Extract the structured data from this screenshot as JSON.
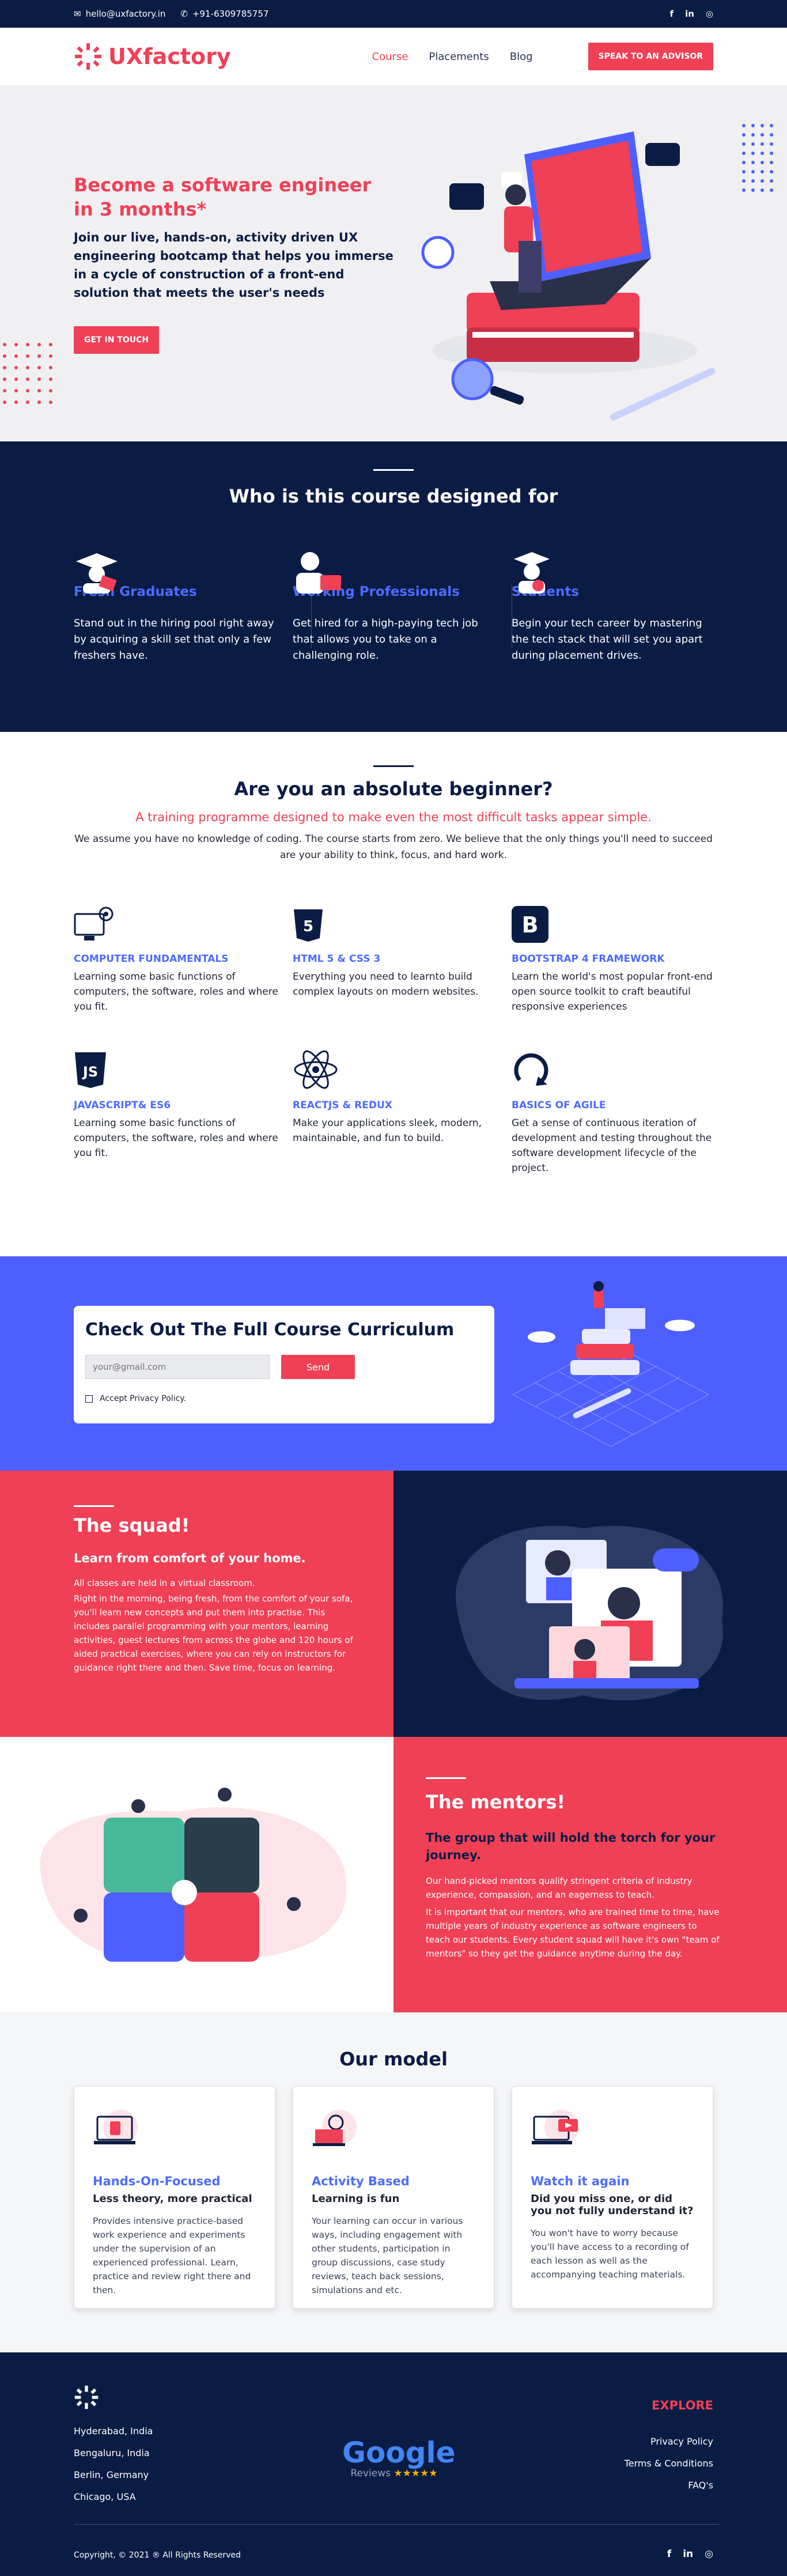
{
  "topbar": {
    "email": "hello@uxfactory.in",
    "phone": "+91-6309785757"
  },
  "brand": {
    "name": "UXfactory"
  },
  "nav": {
    "items": [
      "Course",
      "Placements",
      "Blog"
    ],
    "cta": "SPEAK TO AN ADVISOR"
  },
  "hero": {
    "title": "Become a software engineer in 3 months*",
    "desc": "Join our live, hands-on, activity driven UX engineering bootcamp that helps you immerse in a cycle of construction of a front-end solution that meets the user's needs",
    "cta": "GET IN TOUCH"
  },
  "audience": {
    "title": "Who is this course designed for",
    "cards": [
      {
        "title": "Fresh Graduates",
        "desc": "Stand out in the hiring pool right away by acquiring a skill set that only a few freshers have."
      },
      {
        "title": "Working Professionals",
        "desc": "Get hired for a high-paying tech job that allows you to take on a challenging role."
      },
      {
        "title": "Students",
        "desc": "Begin your tech career by mastering the tech stack that will set you apart during placement drives."
      }
    ]
  },
  "beginner": {
    "title": "Are you an absolute beginner?",
    "subtitle": "A training programme designed to make even the most difficult tasks appear simple.",
    "desc": "We assume you have no knowledge of coding. The course starts from zero. We believe that the only things you'll need to succeed are your ability to think, focus, and hard work.",
    "skills": [
      {
        "title": "COMPUTER FUNDAMENTALS",
        "desc": "Learning some basic functions of computers, the software, roles and where you fit."
      },
      {
        "title": "HTML 5 & CSS 3",
        "desc": "Everything you need to learnto build complex layouts on modern websites."
      },
      {
        "title": "BOOTSTRAP 4 FRAMEWORK",
        "desc": "Learn the world's most popular front-end open source toolkit to craft beautiful responsive experiences"
      },
      {
        "title": "JAVASCRIPT& ES6",
        "desc": "Learning some basic functions of computers, the software, roles and where you fit."
      },
      {
        "title": "REACTJS & REDUX",
        "desc": "Make your applications sleek, modern, maintainable, and fun to build."
      },
      {
        "title": "BASICS OF AGILE",
        "desc": "Get a sense of continuous iteration of development and testing throughout the software development lifecycle of the project."
      }
    ]
  },
  "curriculum": {
    "title": "Check Out The Full Course Curriculum",
    "placeholder": "your@gmail.com",
    "send": "Send",
    "privacy": "Accept Privacy Policy."
  },
  "squad": {
    "title": "The squad!",
    "subtitle": "Learn from comfort of your home.",
    "p1": "All classes are held in a virtual classroom.",
    "p2": "Right in the morning, being fresh, from the comfort of your sofa, you'll learn new concepts and put them into practise. This includes parallel programming with your mentors, learning activities, guest lectures from across the globe and 120 hours of aided practical exercises, where you can rely on instructors for guidance right there and then. Save time, focus on learning."
  },
  "mentors": {
    "title": "The mentors!",
    "subtitle": "The group that will hold the torch for your journey.",
    "p1": "Our hand-picked mentors qualify stringent criteria of industry experience, compassion, and an eagerness to teach.",
    "p2": "It is important that our mentors, who are trained time to time, have multiple years of industry experience as software engineers to teach our students. Every student squad will have it's own \"team of mentors\" so they get the guidance anytime during the day."
  },
  "model": {
    "title": "Our model",
    "cards": [
      {
        "title": "Hands-On-Focused",
        "sub": "Less theory, more practical",
        "desc": "Provides intensive practice-based work experience and experiments under the supervision of an experienced professional. Learn, practice and review right there and then."
      },
      {
        "title": "Activity Based",
        "sub": "Learning is fun",
        "desc": "Your learning can occur in various ways, including engagement with other students, participation in group discussions, case study reviews, teach back sessions, simulations and etc."
      },
      {
        "title": "Watch it again",
        "sub": "Did you miss one, or did you not fully understand it?",
        "desc": "You won't have to worry because you'll have access to a recording of each lesson as well as the accompanying teaching materials."
      }
    ]
  },
  "footer": {
    "cities": [
      "Hyderabad, India",
      "Bengaluru, India",
      "Berlin, Germany",
      "Chicago, USA"
    ],
    "google": "Google",
    "reviews": "Reviews",
    "explore": "EXPLORE",
    "links": [
      "Privacy Policy",
      "Terms & Conditions",
      "FAQ's"
    ],
    "copyright": "Copyright, © 2021 ® All Rights Reserved"
  },
  "colors": {
    "red": "#ef4056",
    "navy": "#0b1c44",
    "blue": "#4e5fff"
  }
}
